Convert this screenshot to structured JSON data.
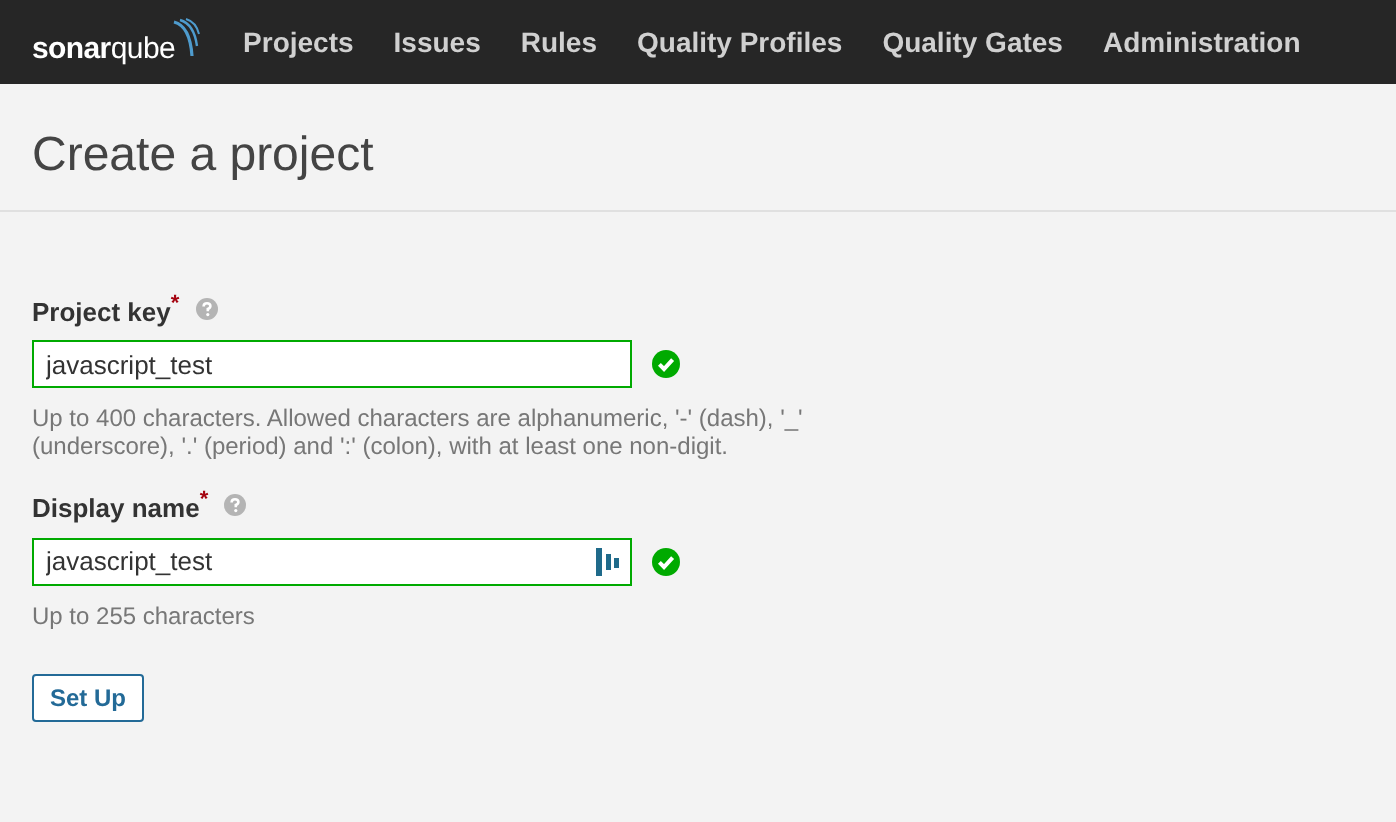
{
  "navbar": {
    "logo": "**sonar**qube",
    "items": [
      "Projects",
      "Issues",
      "Rules",
      "Quality Profiles",
      "Quality Gates",
      "Administration"
    ]
  },
  "page": {
    "title": "Create a project"
  },
  "fields": [
    {
      "label": "Project key",
      "required_mark": "*",
      "value": "javascript_test",
      "valid": true,
      "hint": "Up to 400 characters. Allowed characters are alphanumeric, '-' (dash), '_' (underscore), '.' (period) and ':' (colon), with at least one non-digit.",
      "password_manager_icon": false
    },
    {
      "label": "Display name",
      "required_mark": "*",
      "value": "javascript_test",
      "valid": true,
      "hint": "Up to 255 characters",
      "password_manager_icon": true
    }
  ],
  "buttons": [
    "Set Up"
  ]
}
